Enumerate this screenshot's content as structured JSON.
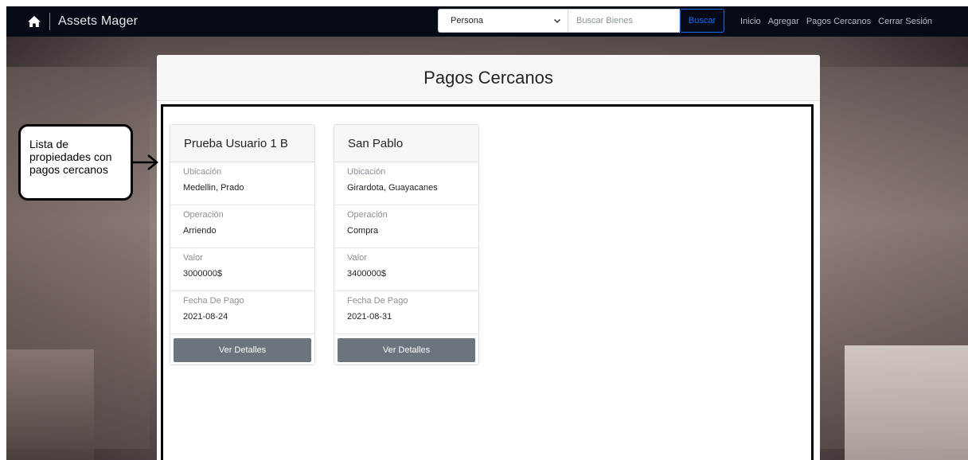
{
  "navbar": {
    "brand_icon": "home-icon",
    "brand_name": "Assets Mager",
    "search": {
      "select_value": "Persona",
      "input_placeholder": "Buscar Bienes",
      "button_label": "Buscar"
    },
    "links": [
      "Inicio",
      "Agregar",
      "Pagos Cercanos",
      "Cerrar Sesión"
    ],
    "colors": {
      "background": "#050a16",
      "link": "#b8bcc2",
      "search_button": "#0d6efd"
    }
  },
  "main": {
    "title": "Pagos Cercanos",
    "cards": [
      {
        "name": "Prueba Usuario 1 B",
        "fields": [
          {
            "label": "Ubicación",
            "value": "Medellin, Prado"
          },
          {
            "label": "Operación",
            "value": "Arriendo"
          },
          {
            "label": "Valor",
            "value": "3000000$"
          },
          {
            "label": "Fecha De Pago",
            "value": "2021-08-24"
          }
        ],
        "button_label": "Ver Detalles"
      },
      {
        "name": "San Pablo",
        "fields": [
          {
            "label": "Ubicación",
            "value": "Girardota, Guayacanes"
          },
          {
            "label": "Operación",
            "value": "Compra"
          },
          {
            "label": "Valor",
            "value": "3400000$"
          },
          {
            "label": "Fecha De Pago",
            "value": "2021-08-31"
          }
        ],
        "button_label": "Ver Detalles"
      }
    ],
    "colors": {
      "details_button": "#6c757d"
    }
  },
  "annotation": {
    "lines": [
      "Lista de",
      "propiedades con",
      "pagos cercanos"
    ]
  }
}
